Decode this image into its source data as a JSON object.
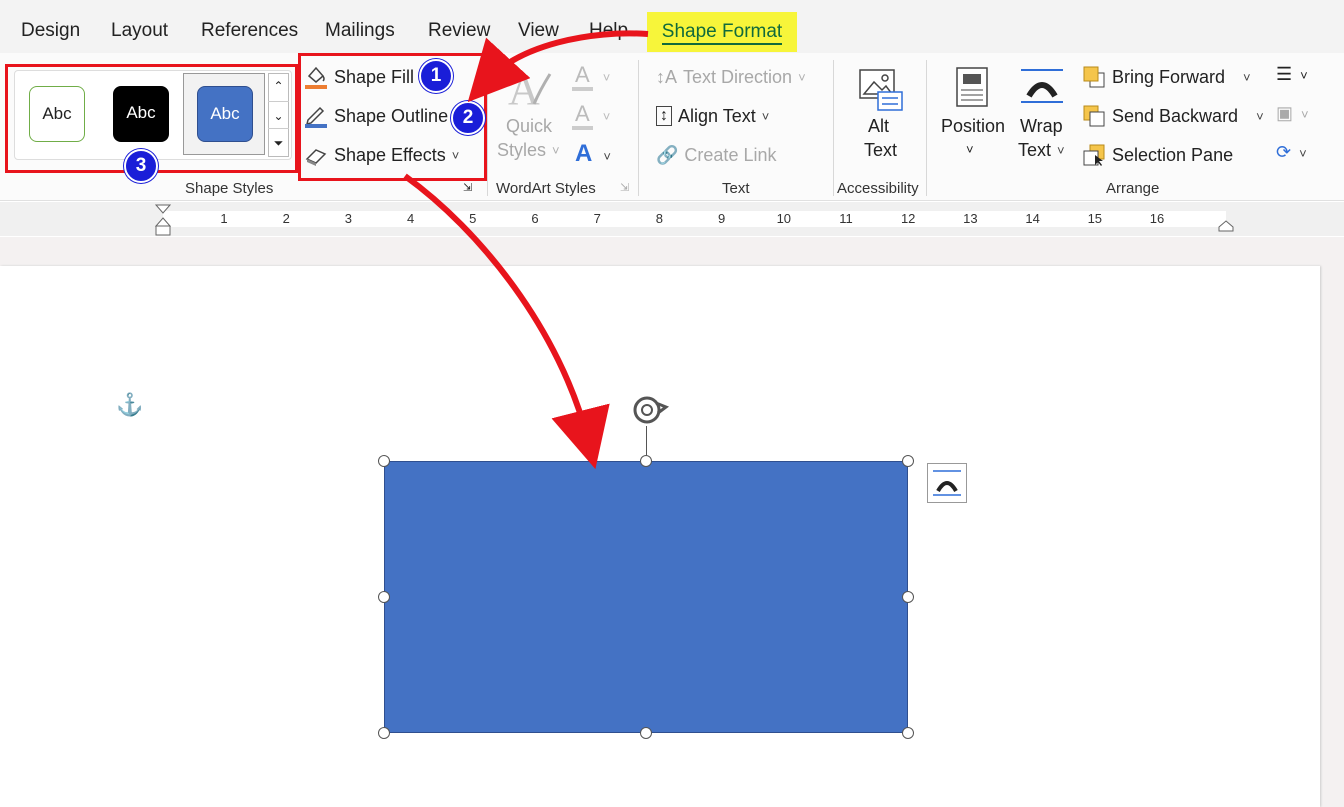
{
  "tabs": [
    {
      "label": "Design"
    },
    {
      "label": "Layout"
    },
    {
      "label": "References"
    },
    {
      "label": "Mailings"
    },
    {
      "label": "Review"
    },
    {
      "label": "View"
    },
    {
      "label": "Help"
    },
    {
      "label": "Shape Format"
    }
  ],
  "shape_styles": {
    "group_label": "Shape Styles",
    "tiles": [
      {
        "label": "Abc",
        "style": "white-green-outline"
      },
      {
        "label": "Abc",
        "style": "black-fill"
      },
      {
        "label": "Abc",
        "style": "blue-fill-selected"
      }
    ]
  },
  "shape_commands": {
    "fill": "Shape Fill",
    "outline": "Shape Outline",
    "effects": "Shape Effects"
  },
  "wordart": {
    "group_label": "WordArt Styles",
    "quick_styles_line1": "Quick",
    "quick_styles_line2": "Styles"
  },
  "text_group": {
    "group_label": "Text",
    "text_direction": "Text Direction",
    "align_text": "Align Text",
    "create_link": "Create Link"
  },
  "accessibility": {
    "group_label": "Accessibility",
    "alt_line1": "Alt",
    "alt_line2": "Text"
  },
  "arrange": {
    "group_label": "Arrange",
    "position": "Position",
    "wrap_line1": "Wrap",
    "wrap_line2": "Text",
    "bring_forward": "Bring Forward",
    "send_backward": "Send Backward",
    "selection_pane": "Selection Pane"
  },
  "badges": [
    "1",
    "2",
    "3"
  ],
  "ruler": {
    "numbers": [
      "1",
      "2",
      "3",
      "4",
      "5",
      "6",
      "7",
      "8",
      "9",
      "10",
      "11",
      "12",
      "13",
      "14",
      "15",
      "16"
    ]
  },
  "colors": {
    "shape_fill": "#4472c4",
    "annotation_red": "#e8141c",
    "badge_blue": "#1a1ed8",
    "highlight_yellow": "#f7f53a",
    "accent_green": "#106a3c"
  }
}
